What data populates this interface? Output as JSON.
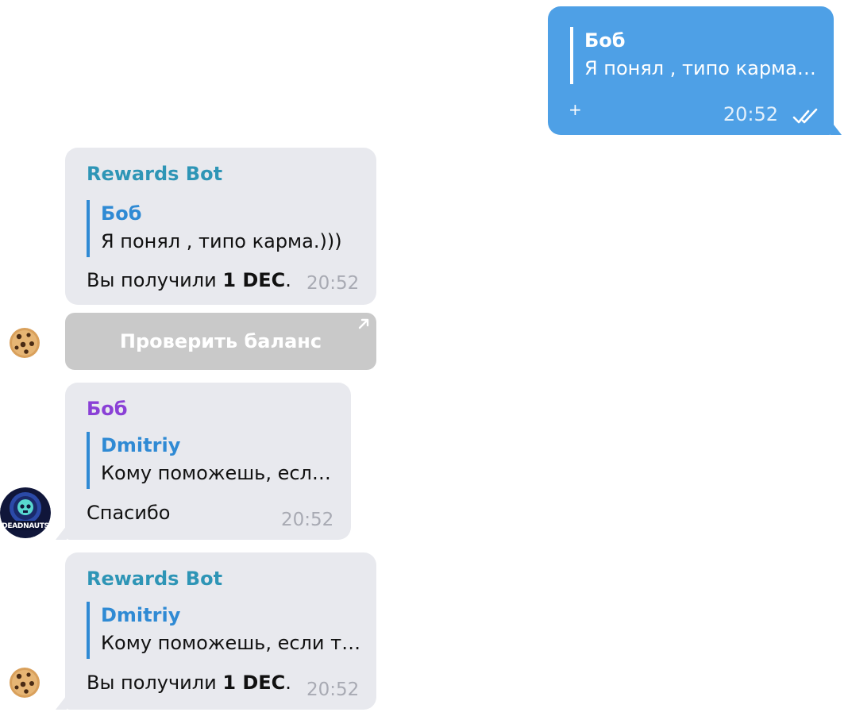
{
  "messages": {
    "outgoing": {
      "reply_author": "Боб",
      "reply_text": "Я понял , типо карма…",
      "plus": "+",
      "time": "20:52"
    },
    "bot1": {
      "sender": "Rewards Bot",
      "reply_author": "Боб",
      "reply_text": "Я понял , типо карма.)))",
      "text_prefix": "Вы получили ",
      "text_bold": "1 DEC",
      "text_suffix": ".",
      "time": "20:52"
    },
    "inline_button": {
      "label": "Проверить баланс"
    },
    "user1": {
      "sender": "Боб",
      "reply_author": "Dmitriy",
      "reply_text": "Кому поможешь, есл…",
      "text": "Спасибо",
      "time": "20:52"
    },
    "bot2": {
      "sender": "Rewards Bot",
      "reply_author": "Dmitriy",
      "reply_text": "Кому поможешь, если т…",
      "text_prefix": "Вы получили ",
      "text_bold": "1 DEC",
      "text_suffix": ".",
      "time": "20:52"
    }
  },
  "avatars": {
    "bot_icon": "cookie-icon",
    "user_icon": "deadnaut-avatar",
    "user_avatar_text": "DEADNAUTS"
  },
  "colors": {
    "outgoing_bubble": "#4ea0e6",
    "incoming_bubble": "#e8e9ee",
    "bot_name": "#2e95b6",
    "user_name": "#8a40d6",
    "reply_accent": "#2f8ad4",
    "button_bg": "#c9c9c9"
  }
}
